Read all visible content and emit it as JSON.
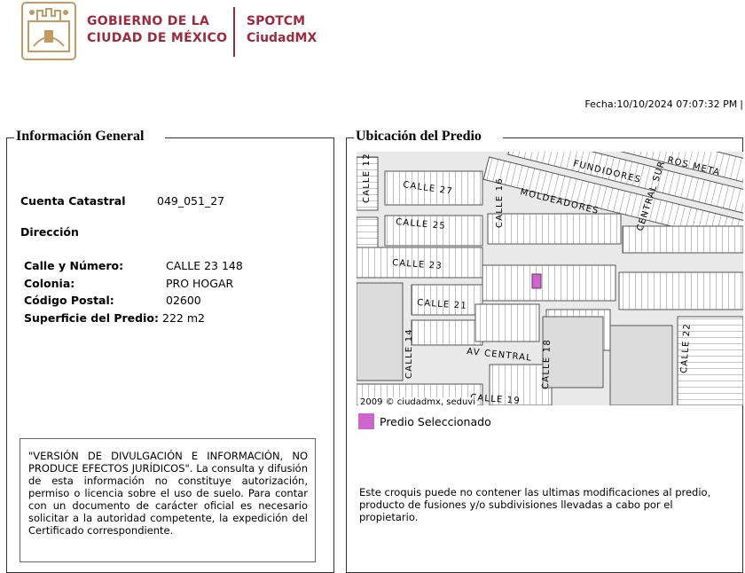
{
  "header": {
    "gov_line1": "GOBIERNO DE LA",
    "gov_line2": "CIUDAD DE MÉXICO",
    "brand_line1": "SPOTCM",
    "brand_line2": "CiudadMX",
    "brand_color": "#9e2a3e",
    "seal_color": "#c49a63"
  },
  "fecha": "Fecha:10/10/2024 07:07:32 PM",
  "fecha_sep": "|",
  "general": {
    "title": "Información General",
    "cuenta_label": "Cuenta Catastral",
    "cuenta_value": "049_051_27",
    "direccion_label": "Dirección",
    "calle_label": "Calle y Número:",
    "calle_value": "CALLE 23 148",
    "colonia_label": "Colonia:",
    "colonia_value": "PRO HOGAR",
    "cp_label": "Código Postal:",
    "cp_value": "02600",
    "superficie_label": "Superficie del Predio:",
    "superficie_value": "222 m2",
    "disclaimer": "\"VERSIÓN DE DIVULGACIÓN E INFORMACIÓN, NO PRODUCE EFECTOS JURÍDICOS\". La consulta y difusión de esta información no constituye autorización, permiso o licencia sobre el uso de suelo. Para contar con un documento de carácter oficial es necesario solicitar a la autoridad competente, la expedición del Certificado correspondiente."
  },
  "ubicacion": {
    "title": "Ubicación del Predio",
    "map_credit": "2009 © ciudadmx, seduvi",
    "legend_label": "Predio Seleccionado",
    "legend_color": "#cc66cc",
    "note": "Este croquis puede no contener las ultimas modificaciones al predio, producto de fusiones y/o subdivisiones llevadas a cabo por el propietario.",
    "streets": [
      "CALLE 12",
      "CALLE 27",
      "CALLE 16",
      "MOLDEADORES",
      "FUNDIDORES",
      "CENTRAL SUR",
      "ROS META",
      "CALLE 25",
      "CALLE 23",
      "CALLE 21",
      "CALLE 14",
      "AV CENTRAL",
      "CALLE 18",
      "CALLE 22",
      "CALLE 19"
    ]
  }
}
